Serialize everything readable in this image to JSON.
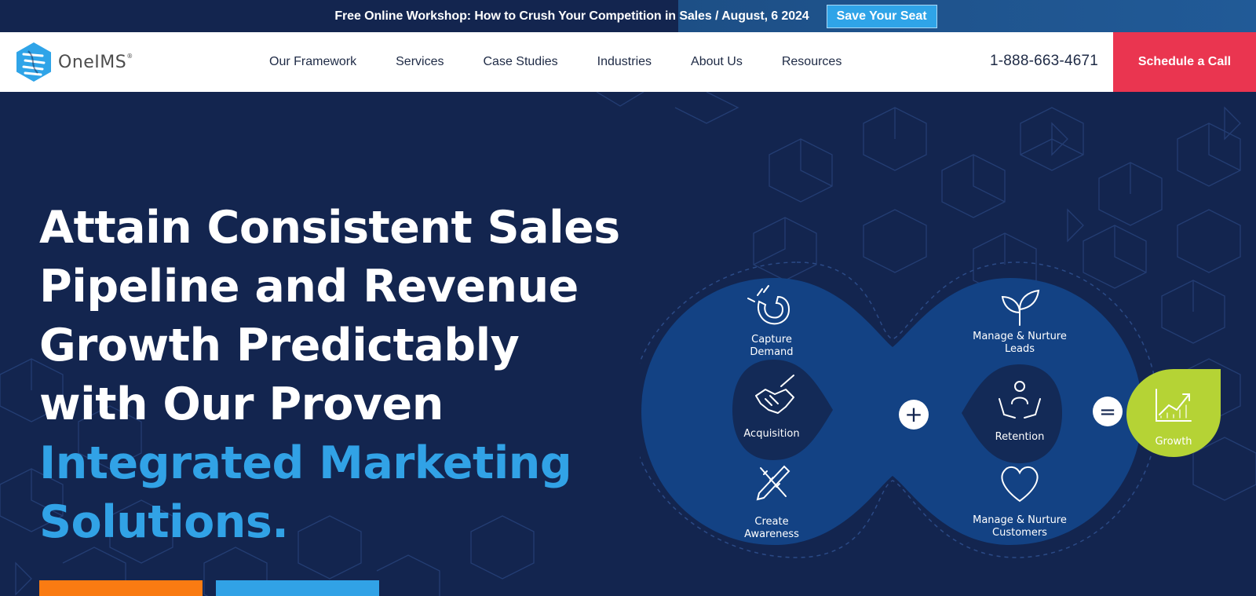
{
  "topbar": {
    "text": "Free Online Workshop: How to Crush Your Competition in Sales / August, 6 2024",
    "button_label": "Save Your Seat"
  },
  "header": {
    "logo_text": "OneIMS",
    "logo_mark": "®",
    "nav": [
      "Our Framework",
      "Services",
      "Case Studies",
      "Industries",
      "About Us",
      "Resources"
    ],
    "phone": "1-888-663-4671",
    "cta_label": "Schedule a Call"
  },
  "hero": {
    "headline_white": [
      "Attain Consistent Sales",
      "Pipeline and Revenue",
      "Growth Predictably",
      "with Our Proven"
    ],
    "headline_blue": [
      "Integrated Marketing",
      "Solutions."
    ]
  },
  "diagram": {
    "capture_demand": [
      "Capture",
      "Demand"
    ],
    "acquisition": "Acquisition",
    "create_awareness": [
      "Create",
      "Awareness"
    ],
    "manage_leads": [
      "Manage & Nurture",
      "Leads"
    ],
    "retention": "Retention",
    "manage_customers": [
      "Manage & Nurture",
      "Customers"
    ],
    "growth": "Growth",
    "plus_symbol": "+",
    "equals_symbol": "="
  },
  "colors": {
    "navy": "#13254f",
    "accent_blue": "#31a2e6",
    "cta_red": "#ea3550",
    "growth_green": "#b5d335",
    "orange": "#fa7b12"
  }
}
